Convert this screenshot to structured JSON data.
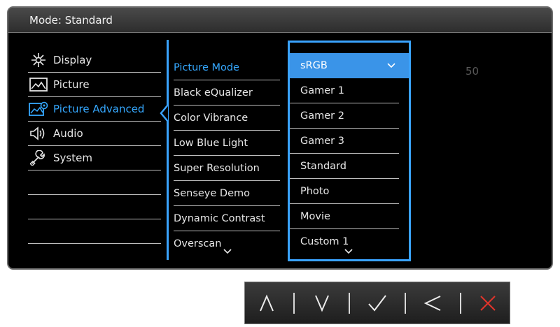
{
  "header": {
    "title": "Mode: Standard"
  },
  "main_menu": {
    "items": [
      {
        "label": "Display",
        "icon": "display-icon"
      },
      {
        "label": "Picture",
        "icon": "picture-icon"
      },
      {
        "label": "Picture Advanced",
        "icon": "picture-advanced-icon",
        "active": true
      },
      {
        "label": "Audio",
        "icon": "audio-icon"
      },
      {
        "label": "System",
        "icon": "system-icon"
      }
    ]
  },
  "sub_menu": {
    "items": [
      {
        "label": "Picture Mode",
        "active": true
      },
      {
        "label": "Black eQualizer"
      },
      {
        "label": "Color Vibrance"
      },
      {
        "label": "Low Blue Light"
      },
      {
        "label": "Super Resolution"
      },
      {
        "label": "Senseye Demo"
      },
      {
        "label": "Dynamic Contrast"
      },
      {
        "label": "Overscan"
      }
    ]
  },
  "options": {
    "items": [
      {
        "label": "sRGB",
        "selected": true
      },
      {
        "label": "Gamer 1"
      },
      {
        "label": "Gamer 2"
      },
      {
        "label": "Gamer 3"
      },
      {
        "label": "Standard"
      },
      {
        "label": "Photo"
      },
      {
        "label": "Movie"
      },
      {
        "label": "Custom 1"
      }
    ]
  },
  "value_display": "50",
  "control_keys": [
    {
      "icon": "up-arrow-icon"
    },
    {
      "icon": "down-arrow-icon"
    },
    {
      "icon": "confirm-check-icon"
    },
    {
      "icon": "back-arrow-icon"
    },
    {
      "icon": "exit-x-icon"
    }
  ],
  "colors": {
    "accent": "#35a8ff",
    "exit": "#e0342b",
    "background": "#000000"
  }
}
